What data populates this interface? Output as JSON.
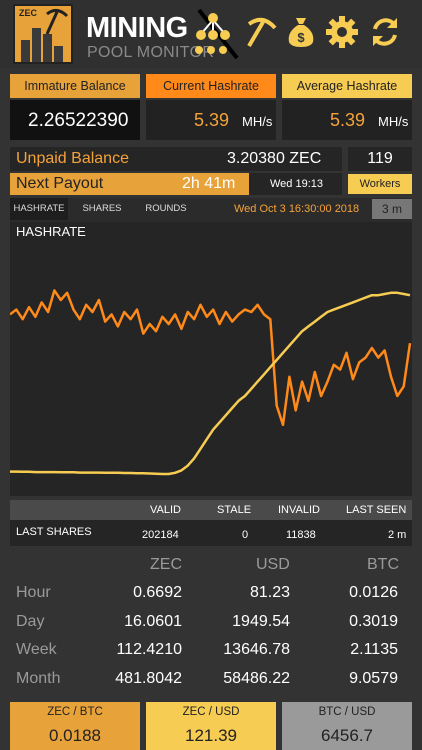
{
  "app": {
    "title": "MINING",
    "subtitle": "POOL MONITOR",
    "logo_text": "ZEC"
  },
  "colors": {
    "accent": "#f4a23a",
    "orange_tab": "#ff8a1a",
    "yellow_tab": "#f6cc52",
    "bg": "#333333"
  },
  "header_icons": [
    "network-icon",
    "pickaxe-icon",
    "money-bag-icon",
    "gear-icon",
    "refresh-icon"
  ],
  "balances": {
    "immature_label": "Immature Balance",
    "immature_value": "2.26522390",
    "current_label": "Current Hashrate",
    "current_value": "5.39",
    "current_unit": "MH/s",
    "average_label": "Average Hashrate",
    "average_value": "5.39",
    "average_unit": "MH/s"
  },
  "unpaid": {
    "label": "Unpaid Balance",
    "value": "3.20380 ZEC",
    "workers_count": "119"
  },
  "payout": {
    "label": "Next Payout",
    "countdown": "2h 41m",
    "progress": 0.72,
    "date": "Wed 19:13",
    "workers_button": "Workers"
  },
  "tabs": {
    "hashrate": "HASHRATE",
    "shares": "SHARES",
    "rounds": "ROUNDS",
    "timestamp": "Wed Oct  3 16:30:00 2018",
    "range": "3 m"
  },
  "chart_data": {
    "type": "line",
    "title": "HASHRATE",
    "xlabel": "",
    "ylabel": "",
    "grid": false,
    "series": [
      {
        "color": "#ff8a1a",
        "values": [
          7.4,
          7.6,
          7.2,
          7.7,
          7.3,
          7.9,
          7.5,
          8.4,
          8.0,
          8.3,
          7.6,
          7.2,
          7.8,
          7.5,
          8.0,
          7.1,
          7.4,
          6.9,
          7.5,
          7.2,
          7.6,
          6.6,
          7.0,
          6.7,
          7.3,
          7.0,
          7.4,
          6.8,
          7.5,
          7.2,
          7.8,
          7.3,
          7.6,
          7.0,
          7.5,
          7.1,
          7.4,
          7.6,
          7.5,
          7.8,
          7.4,
          7.2,
          3.6,
          2.8,
          4.8,
          3.4,
          4.6,
          3.8,
          5.0,
          4.0,
          4.6,
          5.3,
          5.1,
          5.8,
          4.7,
          5.4,
          5.6,
          6.0,
          5.6,
          5.9,
          4.8,
          4.0,
          4.4,
          6.2
        ],
        "ylim": [
          0,
          10
        ]
      },
      {
        "color": "#f6cc52",
        "values": [
          0.85,
          0.85,
          0.84,
          0.84,
          0.83,
          0.83,
          0.83,
          0.83,
          0.82,
          0.82,
          0.82,
          0.81,
          0.81,
          0.81,
          0.81,
          0.8,
          0.8,
          0.8,
          0.79,
          0.79,
          0.78,
          0.78,
          0.77,
          0.76,
          0.75,
          0.75,
          0.8,
          0.9,
          1.1,
          1.4,
          1.8,
          2.2,
          2.6,
          2.9,
          3.2,
          3.5,
          3.8,
          4.0,
          4.3,
          4.6,
          4.9,
          5.2,
          5.5,
          5.8,
          6.1,
          6.4,
          6.7,
          6.9,
          7.1,
          7.3,
          7.5,
          7.6,
          7.7,
          7.8,
          7.9,
          8.0,
          8.1,
          8.2,
          8.2,
          8.25,
          8.3,
          8.3,
          8.25,
          8.2
        ],
        "ylim": [
          0,
          10
        ]
      }
    ]
  },
  "shares": {
    "headers": [
      "VALID",
      "STALE",
      "INVALID",
      "LAST SEEN"
    ],
    "row_label": "LAST SHARES",
    "values": [
      "202184",
      "0",
      "11838",
      "2 m"
    ]
  },
  "earnings": {
    "headers": [
      "ZEC",
      "USD",
      "BTC"
    ],
    "rows": [
      {
        "label": "Hour",
        "values": [
          "0.6692",
          "81.23",
          "0.0126"
        ]
      },
      {
        "label": "Day",
        "values": [
          "16.0601",
          "1949.54",
          "0.3019"
        ]
      },
      {
        "label": "Week",
        "values": [
          "112.4210",
          "13646.78",
          "2.1135"
        ]
      },
      {
        "label": "Month",
        "values": [
          "481.8042",
          "58486.22",
          "9.0579"
        ]
      }
    ]
  },
  "prices": {
    "zec_btc_label": "ZEC / BTC",
    "zec_btc_value": "0.0188",
    "zec_usd_label": "ZEC / USD",
    "zec_usd_value": "121.39",
    "btc_usd_label": "BTC / USD",
    "btc_usd_value": "6456.7"
  }
}
